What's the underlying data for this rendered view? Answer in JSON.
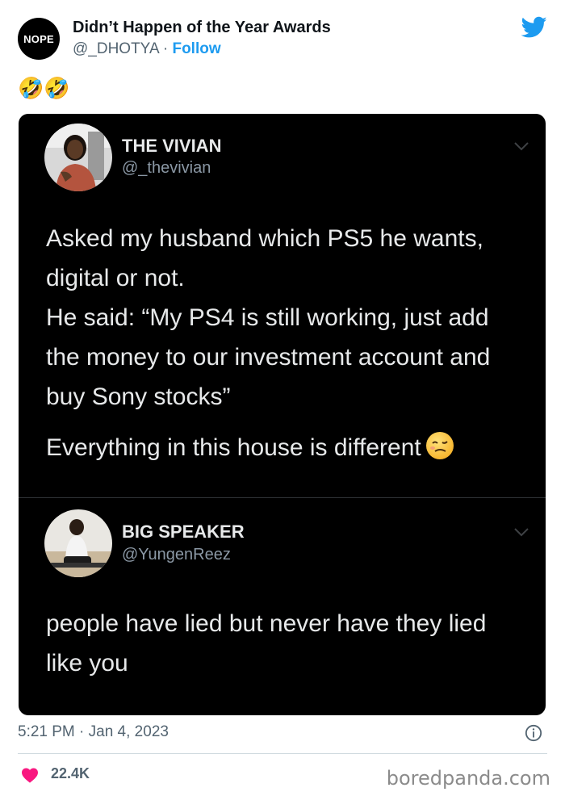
{
  "header": {
    "avatar_text": "NOPE",
    "author_name": "Didn’t Happen of the Year Awards",
    "handle": "@_DHOTYA",
    "separator": " · ",
    "follow_label": "Follow",
    "icon": "twitter-bird-icon",
    "accent_color": "#1d9bf0"
  },
  "tweet_body": {
    "emoji_text": "🤣🤣"
  },
  "embedded_screenshot": {
    "tweets": [
      {
        "name": "THE VIVIAN",
        "handle": "@_thevivian",
        "avatar": "profile-photo-woman",
        "lines": [
          "Asked my husband which PS5 he wants, digital or not.",
          "He said: “My PS4 is still working, just add the money to our investment account and buy Sony stocks”",
          "Everything in this house is different"
        ],
        "trailing_icon": "woozy-face-emoji"
      },
      {
        "name": "BIG SPEAKER",
        "handle": "@YungenReez",
        "avatar": "profile-photo-man",
        "lines": [
          "people have lied but never have they lied like you"
        ]
      }
    ]
  },
  "footer": {
    "timestamp": "5:21 PM · Jan 4, 2023",
    "likes": "22.4K",
    "heart_color": "#f91880",
    "info_icon": "info-icon",
    "watermark": "boredpanda.com"
  }
}
